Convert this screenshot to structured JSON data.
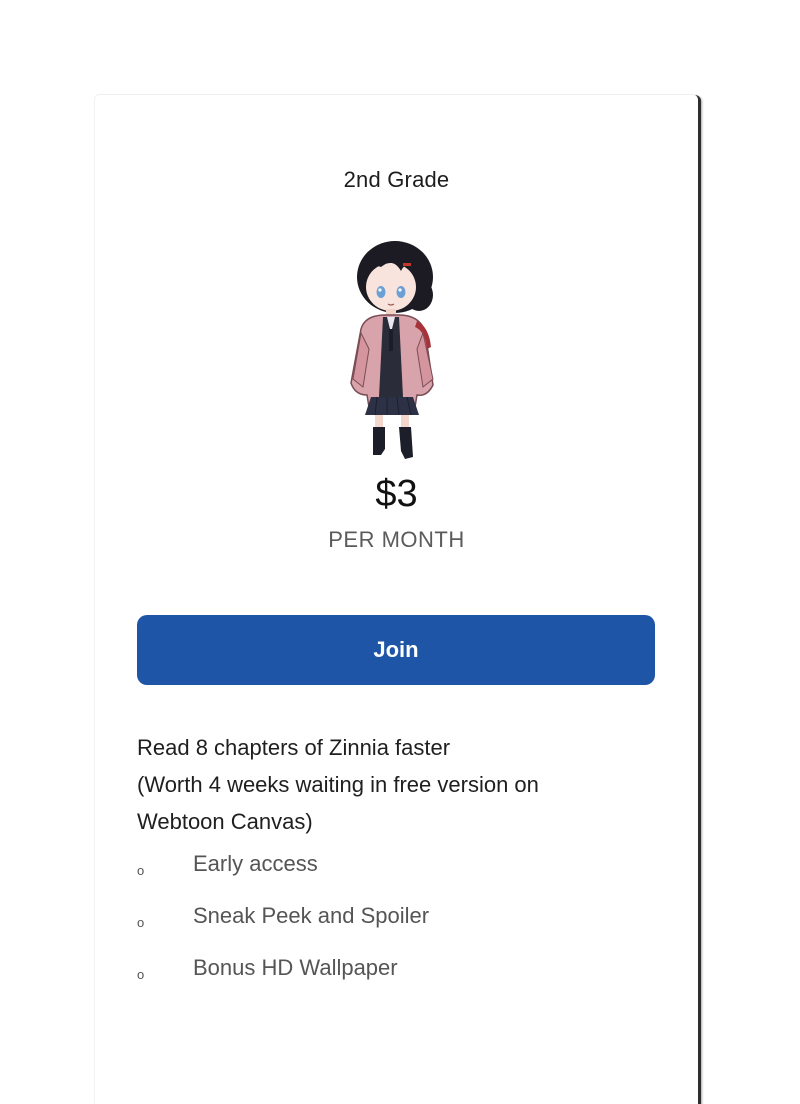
{
  "tier": {
    "title": "2nd Grade",
    "price": "$3",
    "period": "PER MONTH",
    "join_label": "Join",
    "description": [
      "Read 8 chapters of Zinnia faster",
      "(Worth 4 weeks waiting in free version on",
      "Webtoon Canvas)"
    ],
    "benefits": [
      {
        "bullet": "o",
        "label": "Early access"
      },
      {
        "bullet": "o",
        "label": "Sneak Peek and Spoiler"
      },
      {
        "bullet": "o",
        "label": "Bonus HD Wallpaper"
      }
    ]
  },
  "colors": {
    "join_button": "#1f55a6",
    "join_text": "#ffffff",
    "muted_text": "#5b5b5b"
  },
  "icons": {
    "avatar": "chibi-girl-character-illustration"
  }
}
